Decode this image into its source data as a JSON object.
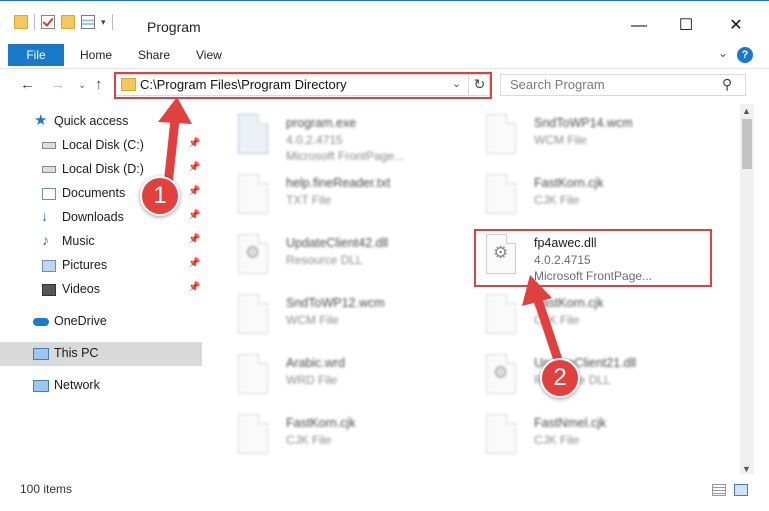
{
  "window": {
    "title": "Program",
    "minimize": "—",
    "maximize": "☐",
    "close": "✕"
  },
  "ribbon": {
    "file": "File",
    "home": "Home",
    "share": "Share",
    "view": "View",
    "expand": "⌄",
    "help": "?"
  },
  "address": {
    "path": "C:\\Program Files\\Program Directory",
    "chevron": "⌄",
    "refresh": "↻"
  },
  "search": {
    "placeholder": "Search Program"
  },
  "nav": {
    "back": "←",
    "forward": "→",
    "recent": "⌄",
    "up": "↑"
  },
  "sidebar": [
    {
      "label": "Quick access",
      "icon": "star-icon",
      "pinned": false
    },
    {
      "label": "Local Disk (C:)",
      "icon": "drive-icon",
      "pinned": true
    },
    {
      "label": "Local Disk (D:)",
      "icon": "drive-icon",
      "pinned": true
    },
    {
      "label": "Documents",
      "icon": "documents-icon",
      "pinned": true
    },
    {
      "label": "Downloads",
      "icon": "download-icon",
      "pinned": true
    },
    {
      "label": "Music",
      "icon": "music-icon",
      "pinned": true
    },
    {
      "label": "Pictures",
      "icon": "pictures-icon",
      "pinned": true
    },
    {
      "label": "Videos",
      "icon": "videos-icon",
      "pinned": true
    },
    {
      "label": "OneDrive",
      "icon": "cloud-icon",
      "pinned": false
    },
    {
      "label": "This PC",
      "icon": "computer-icon",
      "pinned": false
    },
    {
      "label": "Network",
      "icon": "network-icon",
      "pinned": false
    }
  ],
  "pin_glyph": "📌",
  "files": [
    {
      "name": "program.exe",
      "line2": "4.0.2.4715",
      "line3": "Microsoft FrontPage..."
    },
    {
      "name": "SndToWP14.wcm",
      "line2": "WCM File",
      "line3": ""
    },
    {
      "name": "help.fineReader.txt",
      "line2": "TXT File",
      "line3": ""
    },
    {
      "name": "FastKorn.cjk",
      "line2": "CJK File",
      "line3": ""
    },
    {
      "name": "UpdateClient42.dll",
      "line2": "Resource DLL",
      "line3": ""
    },
    {
      "name": "fp4awec.dll",
      "line2": "4.0.2.4715",
      "line3": "Microsoft FrontPage..."
    },
    {
      "name": "SndToWP12.wcm",
      "line2": "WCM File",
      "line3": ""
    },
    {
      "name": "FastKorn.cjk",
      "line2": "CJK File",
      "line3": ""
    },
    {
      "name": "Arabic.wrd",
      "line2": "WRD File",
      "line3": ""
    },
    {
      "name": "UpdateClient21.dll",
      "line2": "Resource DLL",
      "line3": ""
    },
    {
      "name": "FastKorn.cjk",
      "line2": "CJK File",
      "line3": ""
    },
    {
      "name": "FastNmel.cjk",
      "line2": "CJK File",
      "line3": ""
    }
  ],
  "status": {
    "count": "100 items"
  },
  "callouts": {
    "one": "1",
    "two": "2"
  },
  "colors": {
    "accent": "#1979ca",
    "highlight": "#e2403f"
  }
}
